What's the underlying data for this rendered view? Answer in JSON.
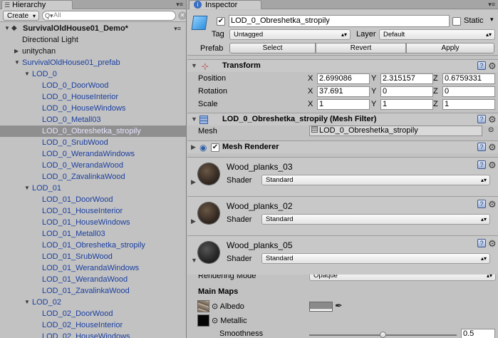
{
  "hierarchy": {
    "tab_title": "Hierarchy",
    "create_label": "Create",
    "search_placeholder": "All",
    "rows": [
      {
        "label": "SurvivalOldHouse01_Demo*",
        "depth": 0,
        "arrow": "open",
        "color": "black",
        "kind": "scene"
      },
      {
        "label": "Directional Light",
        "depth": 1,
        "arrow": "",
        "color": "black"
      },
      {
        "label": "unitychan",
        "depth": 1,
        "arrow": "closed",
        "color": "black"
      },
      {
        "label": "SurvivalOldHouse01_prefab",
        "depth": 1,
        "arrow": "open",
        "color": "blue"
      },
      {
        "label": "LOD_0",
        "depth": 2,
        "arrow": "open",
        "color": "blue"
      },
      {
        "label": "LOD_0_DoorWood",
        "depth": 3,
        "arrow": "",
        "color": "blue"
      },
      {
        "label": "LOD_0_HouseInterior",
        "depth": 3,
        "arrow": "",
        "color": "blue"
      },
      {
        "label": "LOD_0_HouseWindows",
        "depth": 3,
        "arrow": "",
        "color": "blue"
      },
      {
        "label": "LOD_0_Metall03",
        "depth": 3,
        "arrow": "",
        "color": "blue"
      },
      {
        "label": "LOD_0_Obreshetka_stropily",
        "depth": 3,
        "arrow": "",
        "color": "blue",
        "selected": true
      },
      {
        "label": "LOD_0_SrubWood",
        "depth": 3,
        "arrow": "",
        "color": "blue"
      },
      {
        "label": "LOD_0_WerandaWindows",
        "depth": 3,
        "arrow": "",
        "color": "blue"
      },
      {
        "label": "LOD_0_WerandaWood",
        "depth": 3,
        "arrow": "",
        "color": "blue"
      },
      {
        "label": "LOD_0_ZavalinkaWood",
        "depth": 3,
        "arrow": "",
        "color": "blue"
      },
      {
        "label": "LOD_01",
        "depth": 2,
        "arrow": "open",
        "color": "blue"
      },
      {
        "label": "LOD_01_DoorWood",
        "depth": 3,
        "arrow": "",
        "color": "blue"
      },
      {
        "label": "LOD_01_HouseInterior",
        "depth": 3,
        "arrow": "",
        "color": "blue"
      },
      {
        "label": "LOD_01_HouseWindows",
        "depth": 3,
        "arrow": "",
        "color": "blue"
      },
      {
        "label": "LOD_01_Metall03",
        "depth": 3,
        "arrow": "",
        "color": "blue"
      },
      {
        "label": "LOD_01_Obreshetka_stropily",
        "depth": 3,
        "arrow": "",
        "color": "blue"
      },
      {
        "label": "LOD_01_SrubWood",
        "depth": 3,
        "arrow": "",
        "color": "blue"
      },
      {
        "label": "LOD_01_WerandaWindows",
        "depth": 3,
        "arrow": "",
        "color": "blue"
      },
      {
        "label": "LOD_01_WerandaWood",
        "depth": 3,
        "arrow": "",
        "color": "blue"
      },
      {
        "label": "LOD_01_ZavalinkaWood",
        "depth": 3,
        "arrow": "",
        "color": "blue"
      },
      {
        "label": "LOD_02",
        "depth": 2,
        "arrow": "open",
        "color": "blue"
      },
      {
        "label": "LOD_02_DoorWood",
        "depth": 3,
        "arrow": "",
        "color": "blue"
      },
      {
        "label": "LOD_02_HouseInterior",
        "depth": 3,
        "arrow": "",
        "color": "blue"
      },
      {
        "label": "LOD_02_HouseWindows",
        "depth": 3,
        "arrow": "",
        "color": "blue"
      }
    ]
  },
  "inspector": {
    "tab_title": "Inspector",
    "object_name": "LOD_0_Obreshetka_stropily",
    "static_label": "Static",
    "tag_label": "Tag",
    "tag_value": "Untagged",
    "layer_label": "Layer",
    "layer_value": "Default",
    "prefab_label": "Prefab",
    "prefab_select": "Select",
    "prefab_revert": "Revert",
    "prefab_apply": "Apply",
    "transform": {
      "title": "Transform",
      "position_label": "Position",
      "rotation_label": "Rotation",
      "scale_label": "Scale",
      "x": "X",
      "y": "Y",
      "z": "Z",
      "position": [
        "2.699086",
        "2.315157",
        "0.6759331"
      ],
      "rotation": [
        "37.691",
        "0",
        "0"
      ],
      "scale": [
        "1",
        "1",
        "1"
      ]
    },
    "mesh_filter": {
      "title": "LOD_0_Obreshetka_stropily (Mesh Filter)",
      "mesh_label": "Mesh",
      "mesh_value": "LOD_0_Obreshetka_stropily"
    },
    "mesh_renderer": {
      "title": "Mesh Renderer"
    },
    "materials": [
      {
        "name": "Wood_planks_03",
        "shader_label": "Shader",
        "shader": "Standard"
      },
      {
        "name": "Wood_planks_02",
        "shader_label": "Shader",
        "shader": "Standard"
      },
      {
        "name": "Wood_planks_05",
        "shader_label": "Shader",
        "shader": "Standard"
      }
    ],
    "rendering_mode_label": "Rendering Mode",
    "rendering_mode_value": "Opaque",
    "main_maps_label": "Main Maps",
    "albedo_label": "Albedo",
    "metallic_label": "Metallic",
    "smoothness_label": "Smoothness",
    "smoothness_value": "0.5",
    "smoothness_fraction": 0.5
  },
  "colors": {
    "panel": "#c2c2c2",
    "selection": "#8f8f8f",
    "prefab_blue": "#1a3fa0"
  }
}
